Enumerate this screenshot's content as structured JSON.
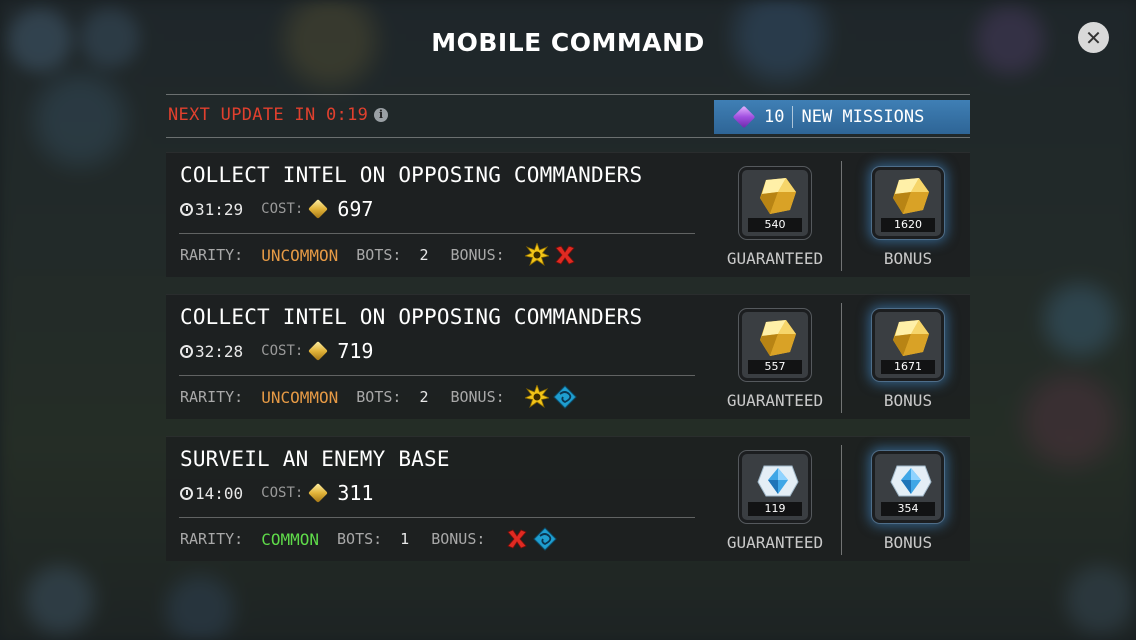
{
  "header": {
    "title": "MOBILE COMMAND",
    "close_icon": "close-icon"
  },
  "topbar": {
    "next_update": "NEXT UPDATE IN 0:19",
    "new_missions_count": "10",
    "new_missions_label": "NEW MISSIONS",
    "colors": {
      "warning": "#e0402e",
      "button": "#3f7fb5"
    }
  },
  "labels": {
    "cost": "COST:",
    "rarity": "RARITY:",
    "bots": "BOTS:",
    "bonus": "BONUS:",
    "guaranteed": "GUARANTEED",
    "bonus_reward": "BONUS"
  },
  "rarity_colors": {
    "UNCOMMON": "#e69a45",
    "COMMON": "#5fdb4a"
  },
  "missions": [
    {
      "title": "COLLECT INTEL ON OPPOSING COMMANDERS",
      "time": "31:29",
      "cost": "697",
      "rarity": "UNCOMMON",
      "bots": "2",
      "bonus_icons": [
        "explosion-icon",
        "red-x-icon"
      ],
      "reward_type": "gold",
      "guaranteed_qty": "540",
      "bonus_qty": "1620"
    },
    {
      "title": "COLLECT INTEL ON OPPOSING COMMANDERS",
      "time": "32:28",
      "cost": "719",
      "rarity": "UNCOMMON",
      "bots": "2",
      "bonus_icons": [
        "explosion-icon",
        "blue-shield-icon"
      ],
      "reward_type": "gold",
      "guaranteed_qty": "557",
      "bonus_qty": "1671"
    },
    {
      "title": "SURVEIL AN ENEMY BASE",
      "time": "14:00",
      "cost": "311",
      "rarity": "COMMON",
      "bots": "1",
      "bonus_icons": [
        "red-x-icon",
        "blue-shield-icon"
      ],
      "reward_type": "crystal",
      "guaranteed_qty": "119",
      "bonus_qty": "354"
    }
  ]
}
